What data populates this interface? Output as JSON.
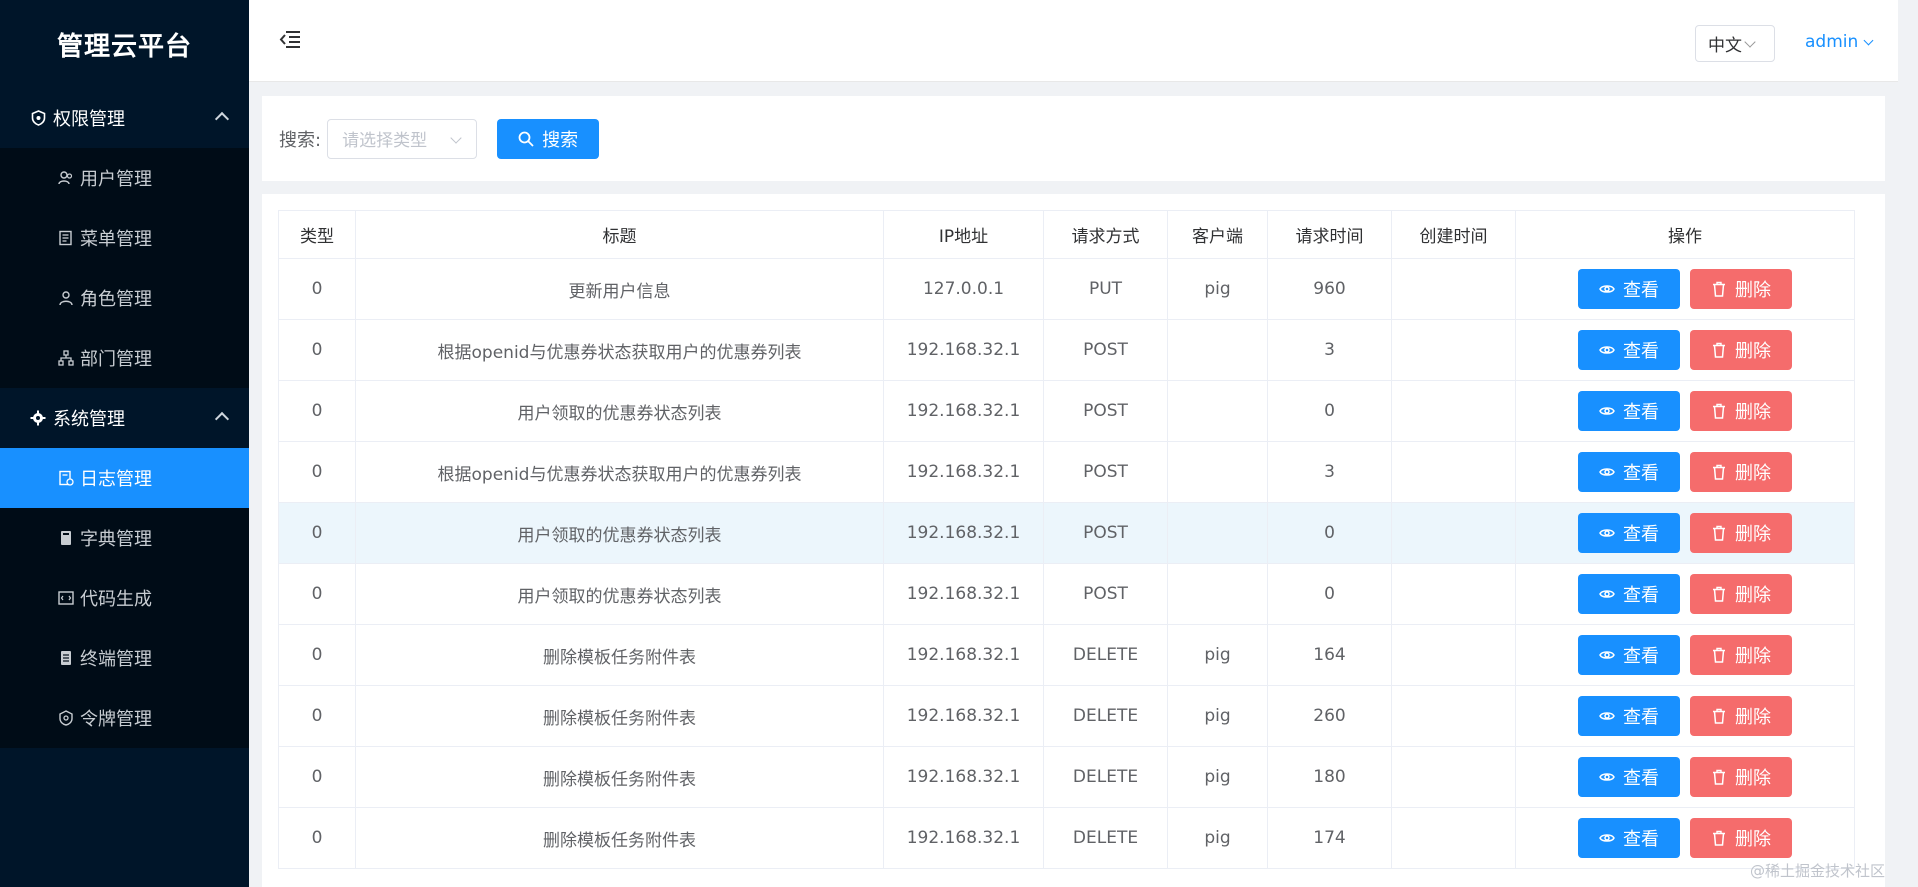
{
  "app": {
    "title": "管理云平台"
  },
  "sidebar": {
    "groups": [
      {
        "label": "权限管理",
        "items": [
          {
            "label": "用户管理",
            "icon": "users-icon",
            "active": false
          },
          {
            "label": "菜单管理",
            "icon": "menu-icon",
            "active": false
          },
          {
            "label": "角色管理",
            "icon": "role-icon",
            "active": false
          },
          {
            "label": "部门管理",
            "icon": "dept-icon",
            "active": false
          }
        ]
      },
      {
        "label": "系统管理",
        "items": [
          {
            "label": "日志管理",
            "icon": "log-icon",
            "active": true
          },
          {
            "label": "字典管理",
            "icon": "dict-icon",
            "active": false
          },
          {
            "label": "代码生成",
            "icon": "code-icon",
            "active": false
          },
          {
            "label": "终端管理",
            "icon": "terminal-icon",
            "active": false
          },
          {
            "label": "令牌管理",
            "icon": "token-icon",
            "active": false
          }
        ]
      }
    ]
  },
  "header": {
    "language": "中文",
    "user": "admin"
  },
  "search": {
    "label": "搜索:",
    "placeholder": "请选择类型",
    "button_label": "搜索"
  },
  "table": {
    "columns": [
      "类型",
      "标题",
      "IP地址",
      "请求方式",
      "客户端",
      "请求时间",
      "创建时间",
      "操作"
    ],
    "view_label": "查看",
    "delete_label": "删除",
    "rows": [
      {
        "type": "0",
        "title": "更新用户信息",
        "ip": "127.0.0.1",
        "method": "PUT",
        "client": "pig",
        "time": "960",
        "created": ""
      },
      {
        "type": "0",
        "title": "根据openid与优惠券状态获取用户的优惠券列表",
        "ip": "192.168.32.1",
        "method": "POST",
        "client": "",
        "time": "3",
        "created": ""
      },
      {
        "type": "0",
        "title": "用户领取的优惠券状态列表",
        "ip": "192.168.32.1",
        "method": "POST",
        "client": "",
        "time": "0",
        "created": ""
      },
      {
        "type": "0",
        "title": "根据openid与优惠券状态获取用户的优惠券列表",
        "ip": "192.168.32.1",
        "method": "POST",
        "client": "",
        "time": "3",
        "created": ""
      },
      {
        "type": "0",
        "title": "用户领取的优惠券状态列表",
        "ip": "192.168.32.1",
        "method": "POST",
        "client": "",
        "time": "0",
        "created": ""
      },
      {
        "type": "0",
        "title": "用户领取的优惠券状态列表",
        "ip": "192.168.32.1",
        "method": "POST",
        "client": "",
        "time": "0",
        "created": ""
      },
      {
        "type": "0",
        "title": "删除模板任务附件表",
        "ip": "192.168.32.1",
        "method": "DELETE",
        "client": "pig",
        "time": "164",
        "created": ""
      },
      {
        "type": "0",
        "title": "删除模板任务附件表",
        "ip": "192.168.32.1",
        "method": "DELETE",
        "client": "pig",
        "time": "260",
        "created": ""
      },
      {
        "type": "0",
        "title": "删除模板任务附件表",
        "ip": "192.168.32.1",
        "method": "DELETE",
        "client": "pig",
        "time": "180",
        "created": ""
      },
      {
        "type": "0",
        "title": "删除模板任务附件表",
        "ip": "192.168.32.1",
        "method": "DELETE",
        "client": "pig",
        "time": "174",
        "created": ""
      }
    ]
  },
  "watermark": "@稀土掘金技术社区",
  "colors": {
    "sidebar_bg": "#001529",
    "submenu_bg": "#000c17",
    "primary": "#1890ff",
    "danger": "#f56c6c"
  }
}
